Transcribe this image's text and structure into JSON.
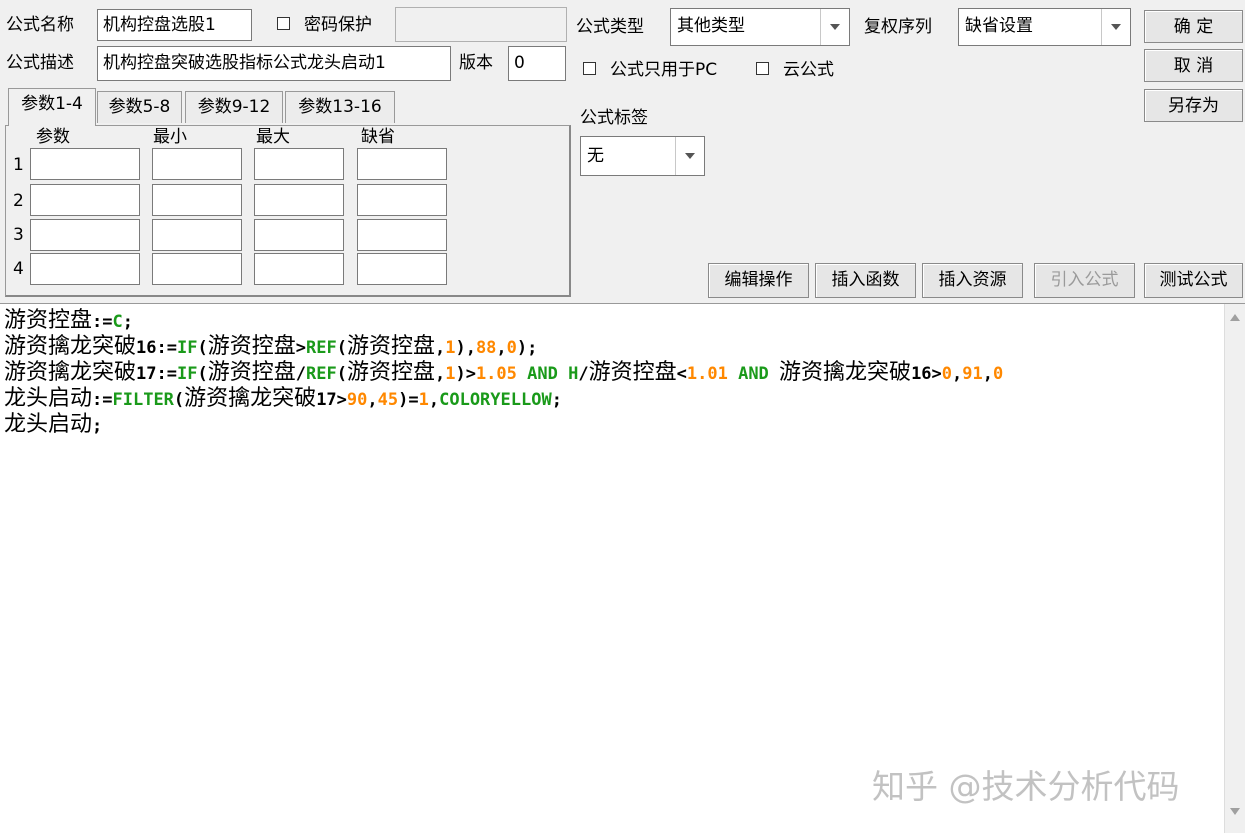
{
  "form": {
    "name_label": "公式名称",
    "name_value": "机构控盘选股1",
    "password_label": "密码保护",
    "password_value": "",
    "desc_label": "公式描述",
    "desc_value": "机构控盘突破选股指标公式龙头启动1",
    "version_label": "版本",
    "version_value": "0",
    "type_label": "公式类型",
    "type_value": "其他类型",
    "fuquan_label": "复权序列",
    "fuquan_value": "缺省设置",
    "pc_only_label": "公式只用于PC",
    "cloud_label": "云公式",
    "tag_label": "公式标签",
    "tag_value": "无"
  },
  "buttons": {
    "ok": "确 定",
    "cancel": "取 消",
    "save_as": "另存为",
    "edit_ops": "编辑操作",
    "insert_func": "插入函数",
    "insert_res": "插入资源",
    "import_formula": "引入公式",
    "test_formula": "测试公式"
  },
  "tabs": [
    "参数1-4",
    "参数5-8",
    "参数9-12",
    "参数13-16"
  ],
  "params": {
    "headers": [
      "参数",
      "最小",
      "最大",
      "缺省"
    ],
    "rows": [
      "1",
      "2",
      "3",
      "4"
    ]
  },
  "code_lines": [
    [
      [
        "cn",
        "游资控盘"
      ],
      [
        "op",
        ":="
      ],
      [
        "fn",
        "C"
      ],
      [
        "op",
        ";"
      ]
    ],
    [
      [
        "cn",
        "游资擒龙突破"
      ],
      [
        "op",
        "16:="
      ],
      [
        "fn",
        "IF"
      ],
      [
        "op",
        "("
      ],
      [
        "cn",
        "游资控盘"
      ],
      [
        "op",
        ">"
      ],
      [
        "fn",
        "REF"
      ],
      [
        "op",
        "("
      ],
      [
        "cn",
        "游资控盘"
      ],
      [
        "op",
        ","
      ],
      [
        "num",
        "1"
      ],
      [
        "op",
        "),"
      ],
      [
        "num",
        "88"
      ],
      [
        "op",
        ","
      ],
      [
        "num",
        "0"
      ],
      [
        "op",
        ");"
      ]
    ],
    [
      [
        "cn",
        "游资擒龙突破"
      ],
      [
        "op",
        "17:="
      ],
      [
        "fn",
        "IF"
      ],
      [
        "op",
        "("
      ],
      [
        "cn",
        "游资控盘"
      ],
      [
        "op",
        "/"
      ],
      [
        "fn",
        "REF"
      ],
      [
        "op",
        "("
      ],
      [
        "cn",
        "游资控盘"
      ],
      [
        "op",
        ","
      ],
      [
        "num",
        "1"
      ],
      [
        "op",
        ")>"
      ],
      [
        "num",
        "1.05"
      ],
      [
        "op",
        " "
      ],
      [
        "fn",
        "AND"
      ],
      [
        "op",
        " "
      ],
      [
        "fn",
        "H"
      ],
      [
        "op",
        "/"
      ],
      [
        "cn",
        "游资控盘"
      ],
      [
        "op",
        "<"
      ],
      [
        "num",
        "1.01"
      ],
      [
        "op",
        " "
      ],
      [
        "fn",
        "AND"
      ],
      [
        "op",
        " "
      ],
      [
        "cn",
        "游资擒龙突破"
      ],
      [
        "op",
        "16>"
      ],
      [
        "num",
        "0"
      ],
      [
        "op",
        ","
      ],
      [
        "num",
        "91"
      ],
      [
        "op",
        ","
      ],
      [
        "num",
        "0"
      ]
    ],
    [
      [
        "cn",
        "龙头启动"
      ],
      [
        "op",
        ":="
      ],
      [
        "fn",
        "FILTER"
      ],
      [
        "op",
        "("
      ],
      [
        "cn",
        "游资擒龙突破"
      ],
      [
        "op",
        "17>"
      ],
      [
        "num",
        "90"
      ],
      [
        "op",
        ","
      ],
      [
        "num",
        "45"
      ],
      [
        "op",
        ")="
      ],
      [
        "num",
        "1"
      ],
      [
        "op",
        ","
      ],
      [
        "fn",
        "COLORYELLOW"
      ],
      [
        "op",
        ";"
      ]
    ],
    [
      [
        "cn",
        "龙头启动"
      ],
      [
        "op",
        ";"
      ]
    ]
  ],
  "watermark": "知乎 @技术分析代码"
}
